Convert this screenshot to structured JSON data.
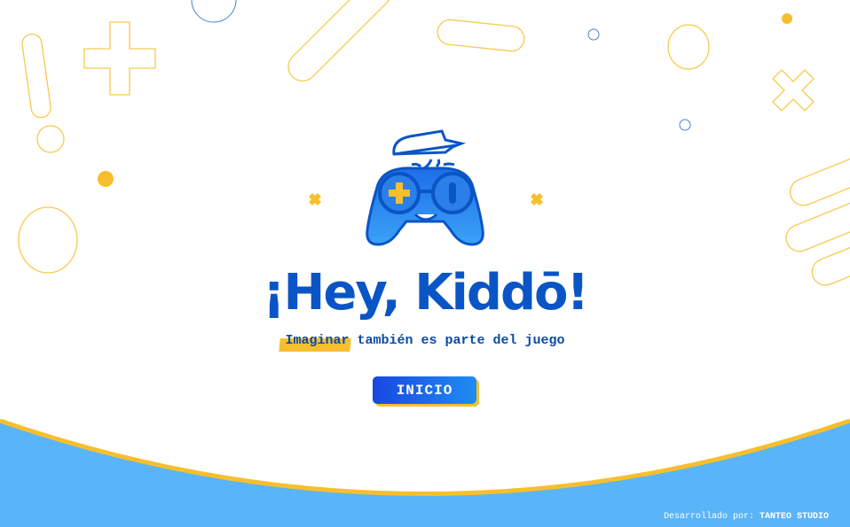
{
  "brand": {
    "title": "¡Hey, Kiddō!"
  },
  "tagline": {
    "highlight": "Imaginar",
    "rest": " también es parte del juego"
  },
  "start_button": {
    "label": "INICIO"
  },
  "footer": {
    "prefix": "Desarrollado por: ",
    "studio": "TANTEO STUDIO"
  },
  "colors": {
    "primary": "#0a55c6",
    "accent": "#f7bf2d",
    "sky": "#5ab4f8",
    "deco_blue": "#4b7fd6"
  },
  "icons": [
    "gamepad-icon",
    "cap-icon",
    "plus-icon",
    "cross-icon"
  ]
}
